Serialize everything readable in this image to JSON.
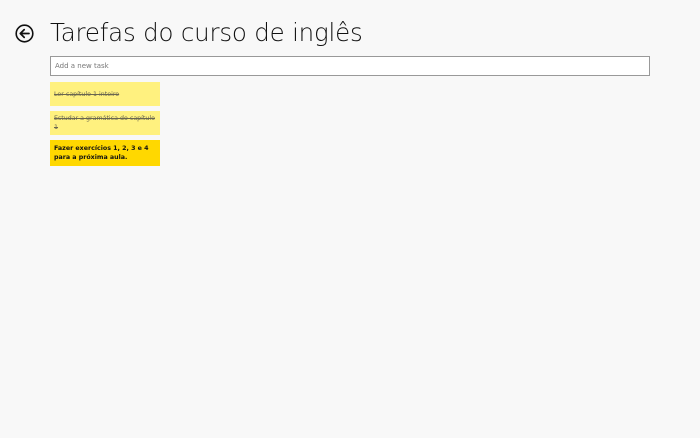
{
  "header": {
    "title": "Tarefas do curso de inglês",
    "back_icon": "back-arrow-circle-icon"
  },
  "new_task": {
    "placeholder": "Add a new task",
    "value": ""
  },
  "tasks": [
    {
      "label": "Ler capítulo 1 inteiro",
      "completed": true
    },
    {
      "label": "Estudar a gramática do capítulo 1",
      "completed": true
    },
    {
      "label": "Fazer exercícios 1, 2, 3 e 4 para a próxima aula.",
      "completed": false
    }
  ],
  "colors": {
    "background": "#f8f8f8",
    "task_completed": "#fff17f",
    "task_pending": "#ffd800"
  }
}
